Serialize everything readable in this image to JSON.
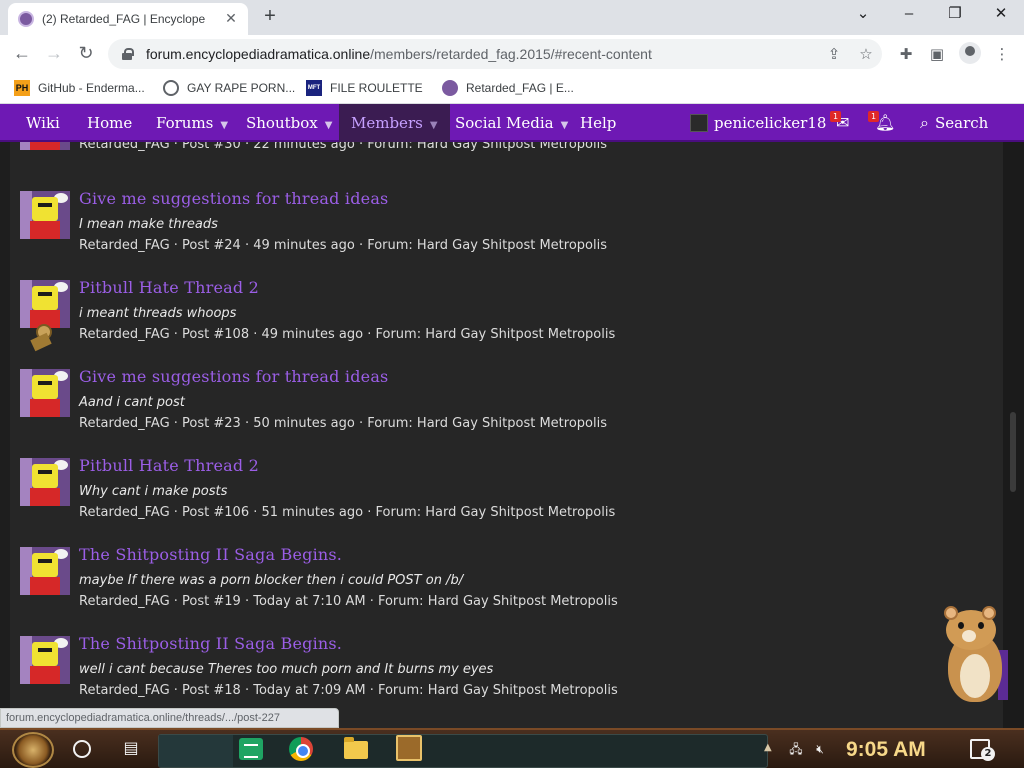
{
  "browser": {
    "tab_title": "(2) Retarded_FAG | Encyclope",
    "url_domain": "forum.encyclopediadramatica.online",
    "url_path": "/members/retarded_fag.2015/#recent-content",
    "status_url": "forum.encyclopediadramatica.online/threads/.../post-227",
    "bookmarks": [
      {
        "icon": "PH",
        "label": "GitHub - Enderma..."
      },
      {
        "icon": "globe-icon",
        "label": "GAY RAPE PORN..."
      },
      {
        "icon": "MFT",
        "label": "FILE ROULETTE"
      },
      {
        "icon": "ed-favicon",
        "label": "Retarded_FAG | E..."
      }
    ]
  },
  "nav": {
    "wiki": "Wiki",
    "home": "Home",
    "forums": "Forums",
    "shoutbox": "Shoutbox",
    "members": "Members",
    "social_media": "Social Media",
    "help": "Help",
    "username": "penicelicker18",
    "inbox_count": "1",
    "alerts_count": "1",
    "search": "Search"
  },
  "partial_post": {
    "meta": "Retarded_FAG · Post #30 · 22 minutes ago · Forum: Hard Gay Shitpost Metropolis"
  },
  "posts": [
    {
      "title": "Give me suggestions for thread ideas",
      "snippet": "I mean make threads",
      "meta": "Retarded_FAG · Post #24 · 49 minutes ago · Forum: Hard Gay Shitpost Metropolis"
    },
    {
      "title": "Pitbull Hate Thread 2",
      "snippet": "i meant threads whoops",
      "meta": "Retarded_FAG · Post #108 · 49 minutes ago · Forum: Hard Gay Shitpost Metropolis"
    },
    {
      "title": "Give me suggestions for thread ideas",
      "snippet": "Aand i cant post",
      "meta": "Retarded_FAG · Post #23 · 50 minutes ago · Forum: Hard Gay Shitpost Metropolis"
    },
    {
      "title": "Pitbull Hate Thread 2",
      "snippet": "Why cant i make posts",
      "meta": "Retarded_FAG · Post #106 · 51 minutes ago · Forum: Hard Gay Shitpost Metropolis"
    },
    {
      "title": "The Shitposting II Saga Begins.",
      "snippet": "maybe If there was a porn blocker then i could POST on /b/",
      "meta": "Retarded_FAG · Post #19 · Today at 7:10 AM · Forum: Hard Gay Shitpost Metropolis"
    },
    {
      "title": "The Shitposting II Saga Begins.",
      "snippet": "well i cant because Theres too much porn and It burns my eyes",
      "meta": "Retarded_FAG · Post #18 · Today at 7:09 AM · Forum: Hard Gay Shitpost Metropolis"
    }
  ],
  "taskbar": {
    "time": "9:05 AM",
    "notification_count": "2"
  },
  "colors": {
    "nav_purple": "#6e19b4",
    "title_purple": "#9b5ee6",
    "clock_gold": "#f7d889"
  }
}
